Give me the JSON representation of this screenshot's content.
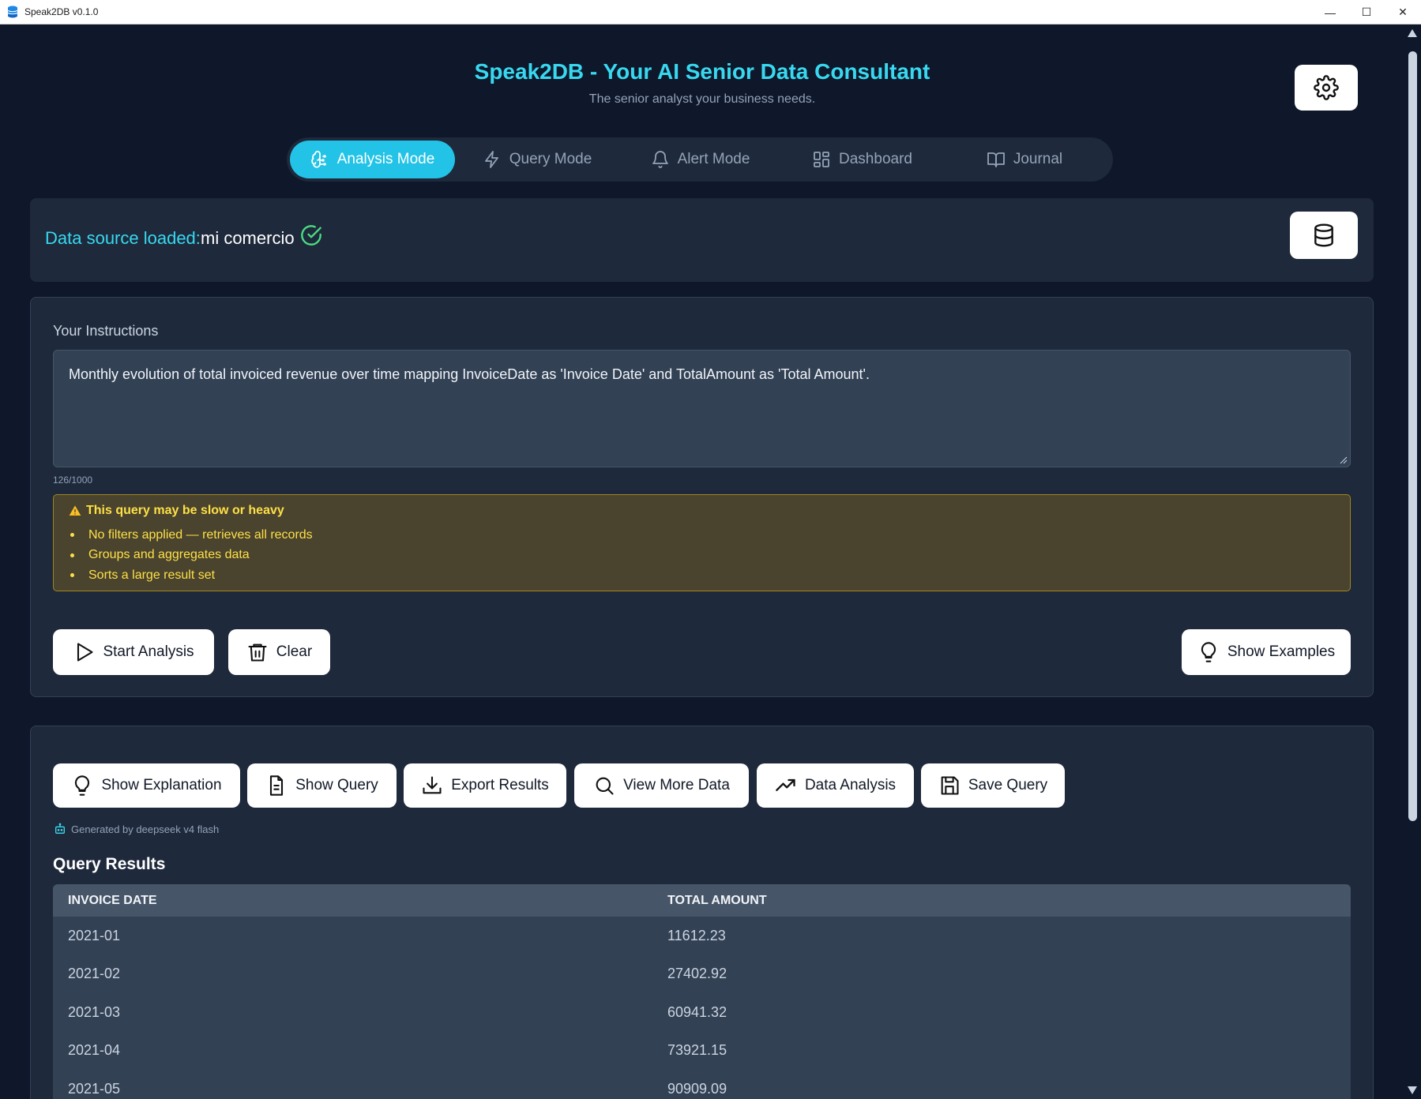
{
  "window": {
    "title": "Speak2DB v0.1.0"
  },
  "header": {
    "title": "Speak2DB - Your AI Senior Data Consultant",
    "subtitle": "The senior analyst your business needs."
  },
  "tabs": [
    {
      "label": "Analysis Mode",
      "icon": "brain-icon",
      "active": true
    },
    {
      "label": "Query Mode",
      "icon": "lightning-icon",
      "active": false
    },
    {
      "label": "Alert Mode",
      "icon": "bell-icon",
      "active": false
    },
    {
      "label": "Dashboard",
      "icon": "grid-icon",
      "active": false
    },
    {
      "label": "Journal",
      "icon": "book-icon",
      "active": false
    }
  ],
  "datasource": {
    "label": "Data source loaded:",
    "name": "mi comercio"
  },
  "instructions": {
    "label": "Your Instructions",
    "text": "Monthly evolution of total invoiced revenue over time mapping InvoiceDate as 'Invoice Date' and TotalAmount as 'Total Amount'.",
    "counter": "126/1000"
  },
  "warning": {
    "title": "This query may be slow or heavy",
    "items": [
      "No filters applied — retrieves all records",
      "Groups and aggregates data",
      "Sorts a large result set"
    ]
  },
  "actions": {
    "start": "Start Analysis",
    "clear": "Clear",
    "examples": "Show Examples"
  },
  "result_actions": {
    "explanation": "Show Explanation",
    "query": "Show Query",
    "export": "Export Results",
    "more": "View More Data",
    "analysis": "Data Analysis",
    "save": "Save Query"
  },
  "generated_by": "Generated by deepseek v4 flash",
  "results": {
    "title": "Query Results",
    "columns": [
      "INVOICE DATE",
      "TOTAL AMOUNT"
    ],
    "rows": [
      [
        "2021-01",
        "11612.23"
      ],
      [
        "2021-02",
        "27402.92"
      ],
      [
        "2021-03",
        "60941.32"
      ],
      [
        "2021-04",
        "73921.15"
      ],
      [
        "2021-05",
        "90909.09"
      ]
    ]
  },
  "colors": {
    "accent": "#22c3e6",
    "background": "#0f172a",
    "panel": "#1e293b",
    "warning": "#fde047"
  }
}
